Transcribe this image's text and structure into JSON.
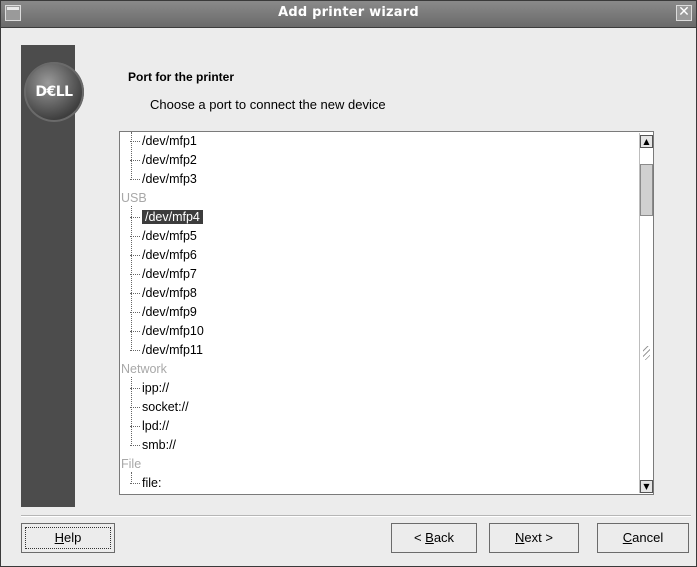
{
  "window": {
    "title": "Add printer wizard",
    "close_glyph": "✕"
  },
  "sidebar": {
    "logo_text": "D€LL",
    "logo_icon": "dell-logo"
  },
  "header": {
    "title": "Port for the printer",
    "subtitle": "Choose a port to connect the new device"
  },
  "ports": {
    "rows": [
      {
        "kind": "item",
        "label": "/dev/mfp1"
      },
      {
        "kind": "item",
        "label": "/dev/mfp2"
      },
      {
        "kind": "item",
        "label": "/dev/mfp3"
      },
      {
        "kind": "group",
        "label": "USB"
      },
      {
        "kind": "item",
        "label": "/dev/mfp4",
        "selected": true
      },
      {
        "kind": "item",
        "label": "/dev/mfp5"
      },
      {
        "kind": "item",
        "label": "/dev/mfp6"
      },
      {
        "kind": "item",
        "label": "/dev/mfp7"
      },
      {
        "kind": "item",
        "label": "/dev/mfp8"
      },
      {
        "kind": "item",
        "label": "/dev/mfp9"
      },
      {
        "kind": "item",
        "label": "/dev/mfp10"
      },
      {
        "kind": "item",
        "label": "/dev/mfp11"
      },
      {
        "kind": "group",
        "label": "Network"
      },
      {
        "kind": "item",
        "label": "ipp://"
      },
      {
        "kind": "item",
        "label": "socket://"
      },
      {
        "kind": "item",
        "label": "lpd://"
      },
      {
        "kind": "item",
        "label": "smb://"
      },
      {
        "kind": "group",
        "label": "File"
      },
      {
        "kind": "item",
        "label": "file:"
      }
    ]
  },
  "buttons": {
    "help": "Help",
    "back": "< Back",
    "next": "Next >",
    "cancel": "Cancel"
  },
  "colors": {
    "sidebar": "#4c4c4c",
    "selection": "#3c3c3c",
    "group_text": "#a8a8a8"
  }
}
